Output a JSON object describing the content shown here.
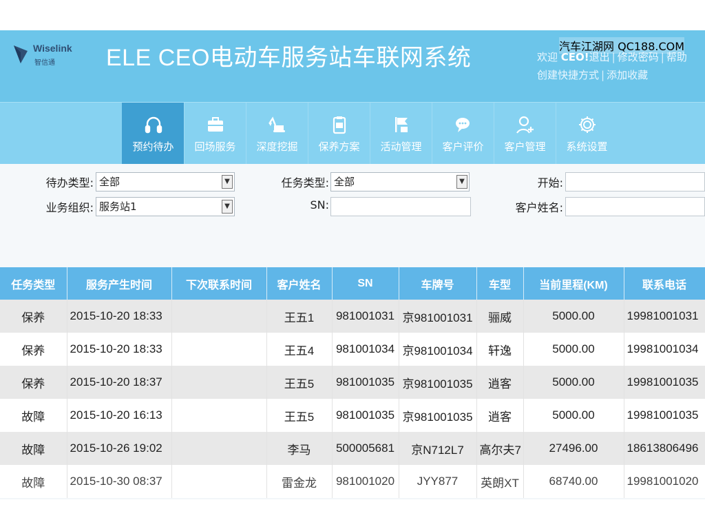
{
  "header": {
    "logo_text": "Wiselink",
    "logo_sub": "智信通",
    "title": "ELE CEO电动车服务站车联网系统",
    "welcome": "欢迎",
    "user": "CEO!",
    "logout": "退出",
    "change_password": "修改密码",
    "help": "帮助",
    "create_shortcut": "创建快捷方式",
    "add_favorite": "添加收藏",
    "watermark": "汽车江湖网 QC188.COM"
  },
  "nav": {
    "items": [
      {
        "label": "预约待办",
        "icon": "headset-icon",
        "active": true
      },
      {
        "label": "回场服务",
        "icon": "toolbox-icon"
      },
      {
        "label": "深度挖掘",
        "icon": "excavator-icon"
      },
      {
        "label": "保养方案",
        "icon": "clipboard-icon"
      },
      {
        "label": "活动管理",
        "icon": "flag-icon"
      },
      {
        "label": "客户评价",
        "icon": "chat-icon"
      },
      {
        "label": "客户管理",
        "icon": "user-add-icon"
      },
      {
        "label": "系统设置",
        "icon": "gear-icon"
      }
    ]
  },
  "filters": {
    "todo_type_label": "待办类型:",
    "todo_type_value": "全部",
    "business_org_label": "业务组织:",
    "business_org_value": "服务站1",
    "task_type_label": "任务类型:",
    "task_type_value": "全部",
    "sn_label": "SN:",
    "sn_value": "",
    "start_label": "开始:",
    "start_value": "",
    "customer_name_label": "客户姓名:",
    "customer_name_value": ""
  },
  "table": {
    "headers": [
      "任务类型",
      "服务产生时间",
      "下次联系时间",
      "客户姓名",
      "SN",
      "车牌号",
      "车型",
      "当前里程(KM)",
      "联系电话"
    ],
    "rows": [
      [
        "保养",
        "2015-10-20 18:33",
        "",
        "王五1",
        "981001031",
        "京981001031",
        "骊威",
        "5000.00",
        "19981001031"
      ],
      [
        "保养",
        "2015-10-20 18:33",
        "",
        "王五4",
        "981001034",
        "京981001034",
        "轩逸",
        "5000.00",
        "19981001034"
      ],
      [
        "保养",
        "2015-10-20 18:37",
        "",
        "王五5",
        "981001035",
        "京981001035",
        "逍客",
        "5000.00",
        "19981001035"
      ],
      [
        "故障",
        "2015-10-20 16:13",
        "",
        "王五5",
        "981001035",
        "京981001035",
        "逍客",
        "5000.00",
        "19981001035"
      ],
      [
        "故障",
        "2015-10-26 19:02",
        "",
        "李马",
        "500005681",
        "京N712L7",
        "高尔夫7",
        "27496.00",
        "18613806496"
      ],
      [
        "故障",
        "2015-10-30 08:37",
        "",
        "雷金龙",
        "981001020",
        "JYY877",
        "英朗XT",
        "68740.00",
        "19981001020"
      ]
    ]
  },
  "colors": {
    "header_bg": "#6cc5ea",
    "nav_bg": "#86d2f1",
    "nav_active": "#3e9fd2",
    "table_header": "#5fb6e8"
  }
}
